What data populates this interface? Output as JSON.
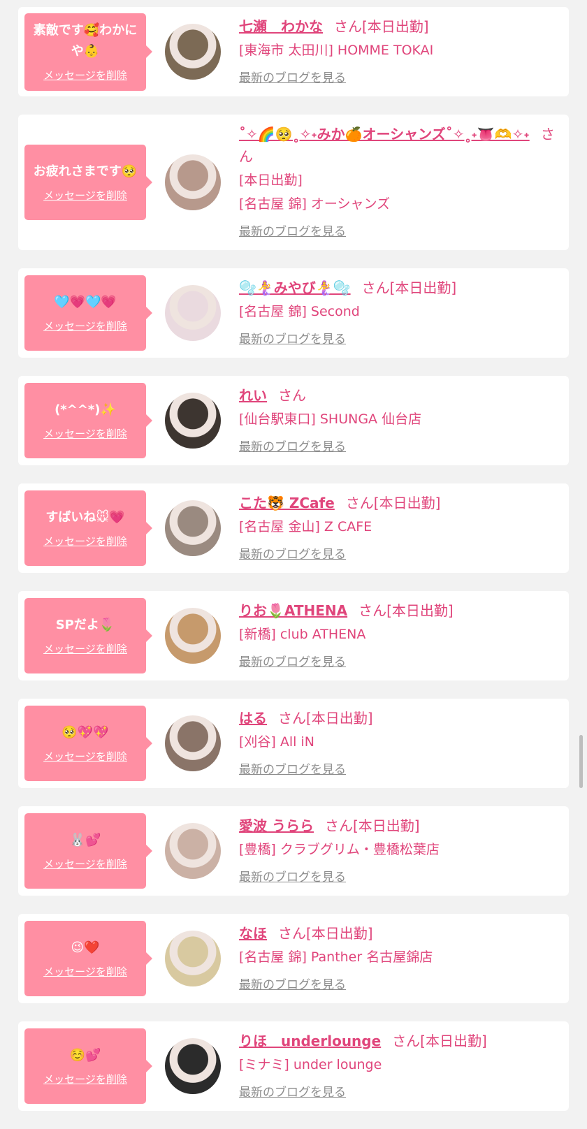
{
  "colors": {
    "pink": "#ff8fa3",
    "name": "#e0457b",
    "link": "#8c8c8c",
    "bg": "#f2f2f2"
  },
  "delete_label": "メッセージを削除",
  "blog_label": "最新のブログを見る",
  "cards": [
    {
      "message": "素敵です🥰わかにや👶",
      "name": "七瀬　わかな",
      "suffix": "さん[本日出勤]",
      "shop": "[東海市 太田川] HOMME TOKAI",
      "avatar_color": "#7c6a55"
    },
    {
      "message": "お疲れさまです🥺",
      "name": "˚✧🌈🥺˳✧˖みか🍊オーシャンズ˚✧˳˖👅🫶✧˖",
      "suffix": "さん",
      "status": "[本日出勤]",
      "shop": "[名古屋 錦] オーシャンズ",
      "avatar_color": "#b7998c"
    },
    {
      "message": "🩵💗🩵💗",
      "name": "🫧🧜‍♀️みやび🧜‍♀️🫧",
      "suffix": "さん[本日出勤]",
      "shop": "[名古屋 錦] Second",
      "avatar_color": "#eadadf"
    },
    {
      "message": "(*^^*)✨",
      "name": "れい",
      "suffix": "さん",
      "shop": "[仙台駅東口] SHUNGA 仙台店",
      "avatar_color": "#3d3530"
    },
    {
      "message": "すばいね🐭💗",
      "name": "こた🐯 ZCafe",
      "suffix": "さん[本日出勤]",
      "shop": "[名古屋 金山] Z CAFE",
      "avatar_color": "#9a8a80"
    },
    {
      "message": "SPだよ🌷",
      "name": "りお🌷ATHENA",
      "suffix": "さん[本日出勤]",
      "shop": "[新橋] club ATHENA",
      "avatar_color": "#c69a6c"
    },
    {
      "message": "🥺💖💖",
      "name": "はる",
      "suffix": "さん[本日出勤]",
      "shop": "[刈谷] All iN",
      "avatar_color": "#8a7468"
    },
    {
      "message": "🐰💕",
      "name": "愛波 うらら",
      "suffix": "さん[本日出勤]",
      "shop": "[豊橋] クラブグリム・豊橋松葉店",
      "avatar_color": "#cbb1a5"
    },
    {
      "message": "😉❤️",
      "name": "なほ",
      "suffix": "さん[本日出勤]",
      "shop": "[名古屋 錦] Panther 名古屋錦店",
      "avatar_color": "#d8c9a0"
    },
    {
      "message": "☺️💕",
      "name": "りほ　underlounge",
      "suffix": "さん[本日出勤]",
      "shop": "[ミナミ] under lounge",
      "avatar_color": "#2b2b2b"
    }
  ]
}
